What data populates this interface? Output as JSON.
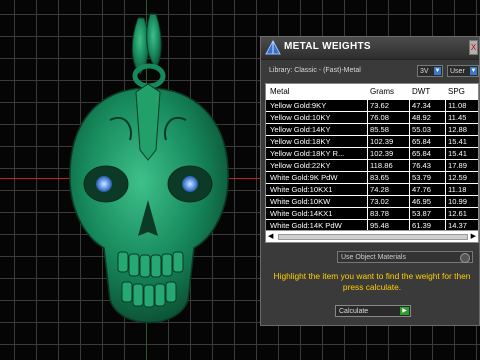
{
  "window": {
    "title": "METAL WEIGHTS",
    "close_label": "X"
  },
  "toolbar": {
    "library_label": "Library: Classic - (Fast)-Metal",
    "unit_value": "3V",
    "user_value": "User"
  },
  "table": {
    "columns": [
      "Metal",
      "Grams",
      "DWT",
      "SPG"
    ],
    "rows": [
      [
        "Yellow Gold:9KY",
        "73.62",
        "47.34",
        "11.08"
      ],
      [
        "Yellow Gold:10KY",
        "76.08",
        "48.92",
        "11.45"
      ],
      [
        "Yellow Gold:14KY",
        "85.58",
        "55.03",
        "12.88"
      ],
      [
        "Yellow Gold:18KY",
        "102.39",
        "65.84",
        "15.41"
      ],
      [
        "Yellow Gold:18KY R...",
        "102.39",
        "65.84",
        "15.41"
      ],
      [
        "Yellow Gold:22KY",
        "118.86",
        "76.43",
        "17.89"
      ],
      [
        "White Gold:9K PdW",
        "83.65",
        "53.79",
        "12.59"
      ],
      [
        "White Gold:10KX1",
        "74.28",
        "47.76",
        "11.18"
      ],
      [
        "White Gold:10KW",
        "73.02",
        "46.95",
        "10.99"
      ],
      [
        "White Gold:14KX1",
        "83.78",
        "53.87",
        "12.61"
      ],
      [
        "White Gold:14K PdW",
        "95.48",
        "61.39",
        "14.37"
      ]
    ]
  },
  "options": {
    "use_object_materials": "Use Object Materials"
  },
  "instruction": "Highlight the item you want to find the weight for then press calculate.",
  "calculate_label": "Calculate",
  "colors": {
    "instruction": "#ffd000",
    "model": "#1a8a5a",
    "eyes": "#7ab0ff"
  },
  "icons": {
    "app": "pyramid-icon",
    "dropdown": "chevron-down-icon",
    "go": "play-icon"
  }
}
